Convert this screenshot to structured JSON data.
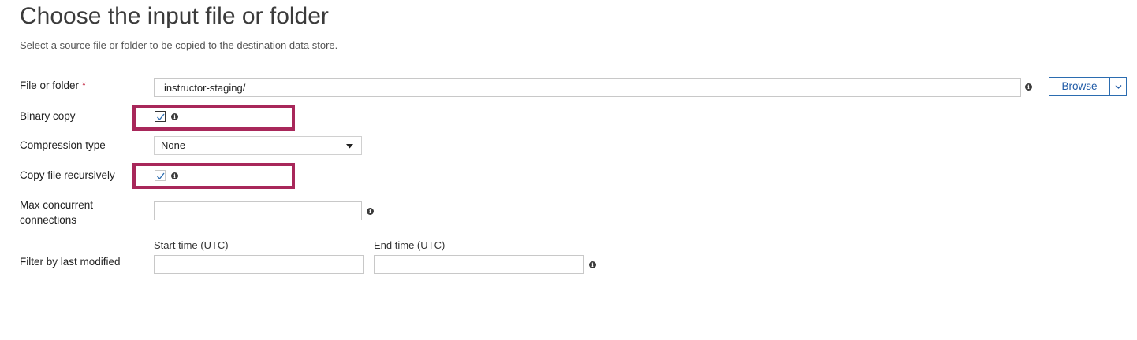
{
  "page": {
    "title": "Choose the input file or folder",
    "subtitle": "Select a source file or folder to be copied to the destination data store."
  },
  "fields": {
    "file_or_folder": {
      "label": "File or folder",
      "required_mark": "*",
      "value": "instructor-staging/",
      "browse_label": "Browse"
    },
    "binary_copy": {
      "label": "Binary copy",
      "checked": true
    },
    "compression_type": {
      "label": "Compression type",
      "value": "None"
    },
    "copy_recursively": {
      "label": "Copy file recursively",
      "checked": true
    },
    "max_connections": {
      "label_line1": "Max concurrent",
      "label_line2": "connections",
      "value": ""
    },
    "filter_modified": {
      "label": "Filter by last modified",
      "start_label": "Start time (UTC)",
      "end_label": "End time (UTC)",
      "start_value": "",
      "end_value": ""
    }
  },
  "icons": {
    "info": "info-icon",
    "checkmark": "checkmark-icon",
    "dropdown": "chevron-down-icon"
  },
  "colors": {
    "highlight": "#a8275a",
    "browse": "#2b6cb0",
    "required": "#c4314b"
  }
}
